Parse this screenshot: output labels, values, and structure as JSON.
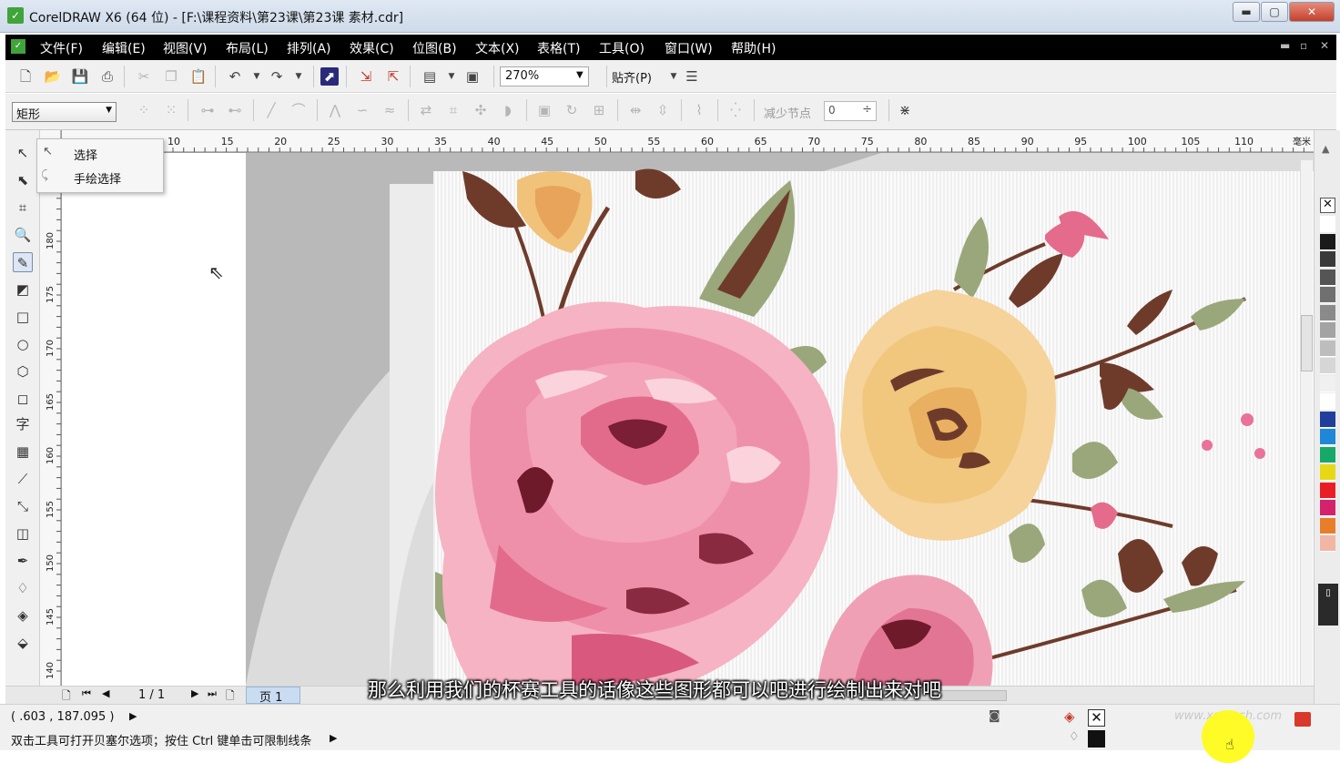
{
  "window": {
    "title": "CorelDRAW X6 (64 位) - [F:\\课程资料\\第23课\\第23课 素材.cdr]",
    "minimize": "▬",
    "maximize": "▢",
    "close": "✕"
  },
  "menubar": {
    "items": [
      "文件(F)",
      "编辑(E)",
      "视图(V)",
      "布局(L)",
      "排列(A)",
      "效果(C)",
      "位图(B)",
      "文本(X)",
      "表格(T)",
      "工具(O)",
      "窗口(W)",
      "帮助(H)"
    ]
  },
  "toolbar1": {
    "zoom_value": "270%",
    "snap_label": "贴齐(P)"
  },
  "toolbar2": {
    "shape_type": "矩形",
    "reduce_nodes_label": "减少节点",
    "reduce_nodes_value": "0"
  },
  "flyout": {
    "items": [
      "选择",
      "手绘选择"
    ]
  },
  "ruler": {
    "horizontal_labels": [
      "10",
      "15",
      "20",
      "25",
      "30",
      "35",
      "40",
      "45",
      "50",
      "55",
      "60",
      "65",
      "70",
      "75",
      "80",
      "85",
      "90",
      "95",
      "100",
      "105",
      "110"
    ],
    "horizontal_unit": "毫米",
    "vertical_labels": [
      "180",
      "175",
      "170",
      "165",
      "160",
      "155",
      "150",
      "145",
      "140"
    ]
  },
  "page_nav": {
    "counter": "1 / 1",
    "page_tab": "页 1"
  },
  "status": {
    "coordinates": "( .603 , 187.095 )",
    "hint": "双击工具可打开贝塞尔选项；按住 Ctrl 键单击可限制线条"
  },
  "subtitle": "那么利用我们的杯赛工具的话像这些图形都可以吧进行绘制出来对吧",
  "watermark": "www.xsteach.com",
  "palette": [
    "#ffffff",
    "#1a1a1a",
    "#3a3a3a",
    "#555555",
    "#707070",
    "#8a8a8a",
    "#a3a3a3",
    "#bdbdbd",
    "#d6d6d6",
    "#f0f0f0",
    "#ffffff",
    "#1f3f9a",
    "#1f88d6",
    "#17a86a",
    "#e6d817",
    "#e81e24",
    "#d4226c",
    "#e87d2a",
    "#f2b6a5"
  ]
}
